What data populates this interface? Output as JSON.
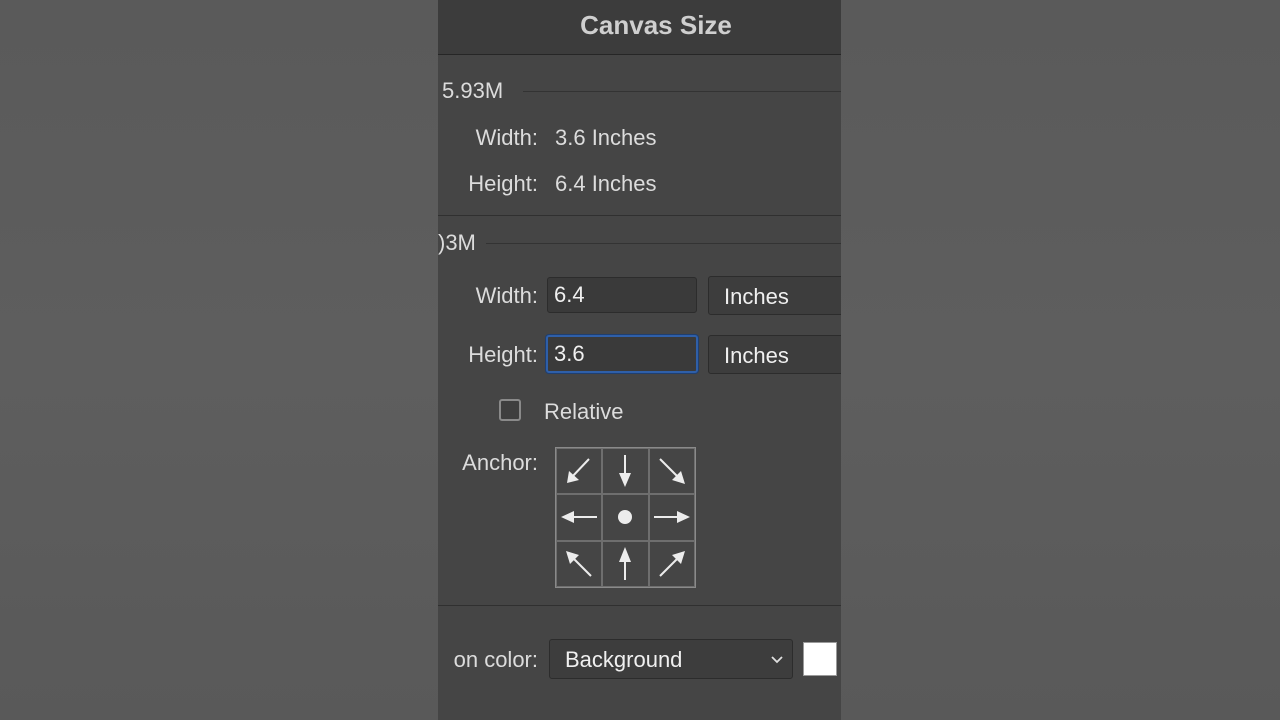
{
  "dialog": {
    "title": "Canvas Size"
  },
  "current_size": {
    "header": "5.93M",
    "width_label": "Width:",
    "width_value": "3.6 Inches",
    "height_label": "Height:",
    "height_value": "6.4 Inches"
  },
  "new_size": {
    "header": ")3M",
    "width_label": "Width:",
    "width_value": "6.4",
    "width_unit": "Inches",
    "height_label": "Height:",
    "height_value": "3.6",
    "height_unit": "Inches",
    "relative_label": "Relative",
    "relative_checked": false,
    "anchor_label": "Anchor:",
    "anchor_cells": [
      "arrow-up-left-icon",
      "arrow-up-icon",
      "arrow-up-right-icon",
      "arrow-left-icon",
      "anchor-center-dot-icon",
      "arrow-right-icon",
      "arrow-down-left-icon",
      "arrow-down-icon",
      "arrow-down-right-icon"
    ]
  },
  "extension_color": {
    "label": "on color:",
    "value": "Background",
    "swatch_color": "#ffffff"
  },
  "colors": {
    "focus_ring": "#2f5fa8",
    "panel_bg": "#454545"
  }
}
